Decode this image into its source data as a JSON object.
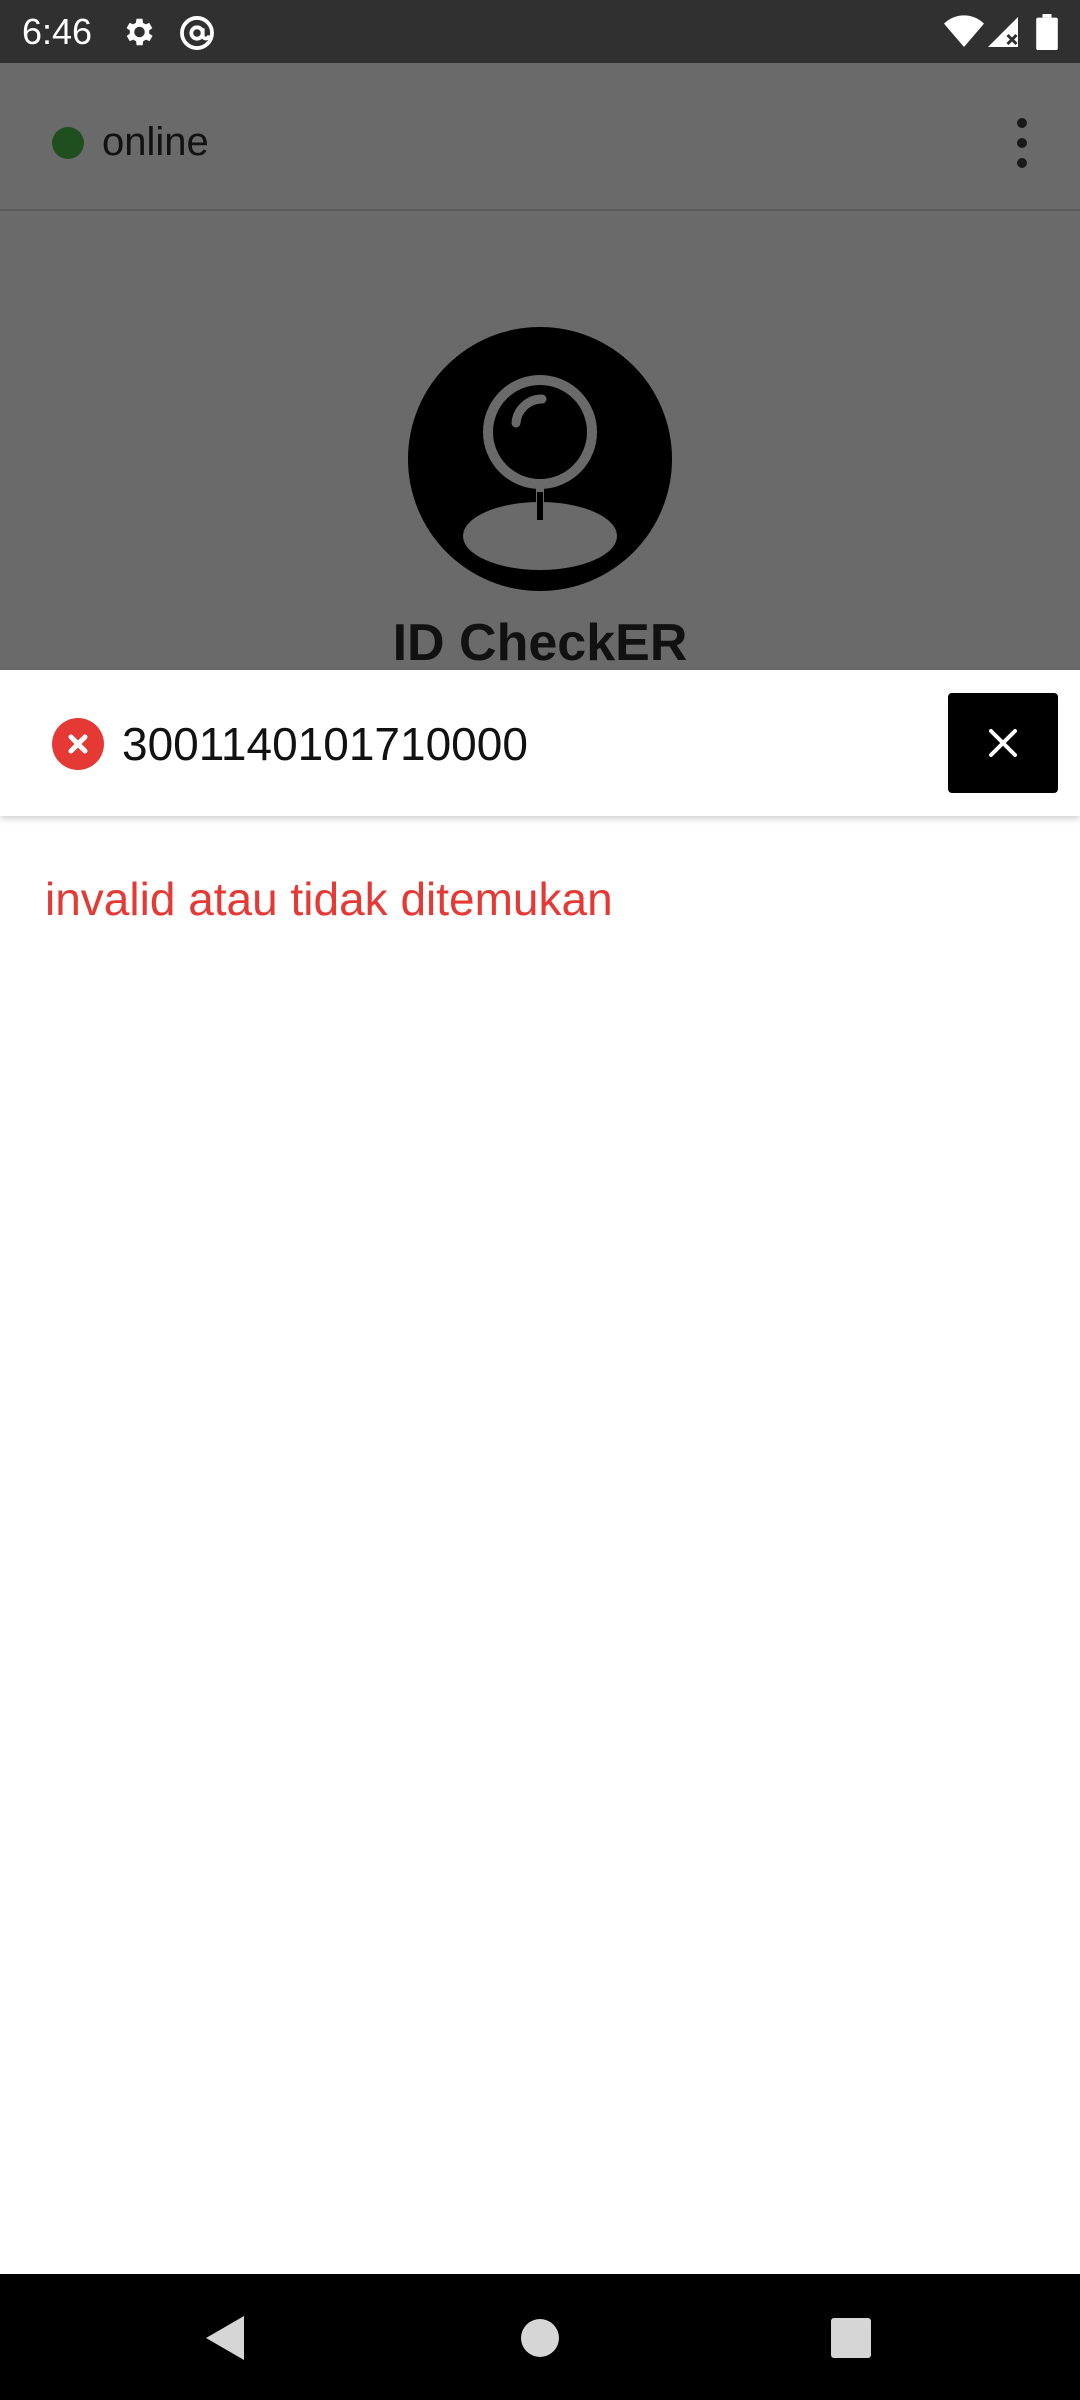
{
  "status_bar": {
    "time": "6:46",
    "icons": [
      "gear-icon",
      "at-sign-icon",
      "wifi-icon",
      "signal-icon",
      "battery-icon"
    ]
  },
  "app_bar": {
    "connection_status": "online",
    "connection_color": "#1f4f1f",
    "menu_icon": "more-vert-icon"
  },
  "app": {
    "logo_icon": "person-search-logo",
    "title": "ID CheckER"
  },
  "search": {
    "status_icon": "error-close-icon",
    "value": "3001140101710000",
    "close_icon": "close-icon"
  },
  "result": {
    "message": "invalid atau tidak ditemukan",
    "color": "#e53935"
  },
  "nav_bar": {
    "buttons": [
      "back-icon",
      "home-icon",
      "recents-icon"
    ]
  }
}
